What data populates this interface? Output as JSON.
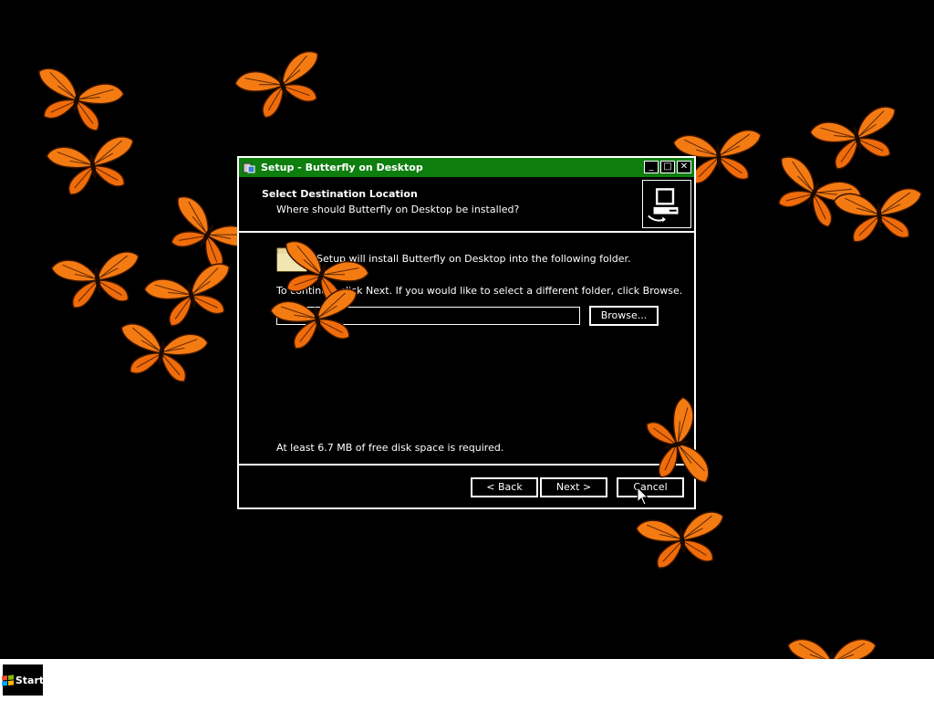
{
  "window": {
    "title": "Setup - Butterfly on Desktop",
    "controls": {
      "minimize": "_",
      "maximize": "□",
      "close": "✕"
    }
  },
  "header": {
    "title": "Select Destination Location",
    "subtitle": "Where should Butterfly on Desktop be installed?",
    "image_icon": "computer-install-icon"
  },
  "body": {
    "install_text": "Setup will install Butterfly on Desktop into the following folder.",
    "continue_text": "To continue, click Next. If you would like to select a different folder, click Browse.",
    "path_value": "",
    "browse_label": "Browse...",
    "disk_space_text": "At least 6.7 MB of free disk space is required."
  },
  "buttons": {
    "back": "< Back",
    "next": "Next >",
    "cancel": "Cancel"
  },
  "taskbar": {
    "start_label": "Start"
  },
  "colors": {
    "titlebar": "#0e7e0e",
    "butterfly": "#f47a12",
    "background": "#000000",
    "taskbar": "#ffffff"
  }
}
